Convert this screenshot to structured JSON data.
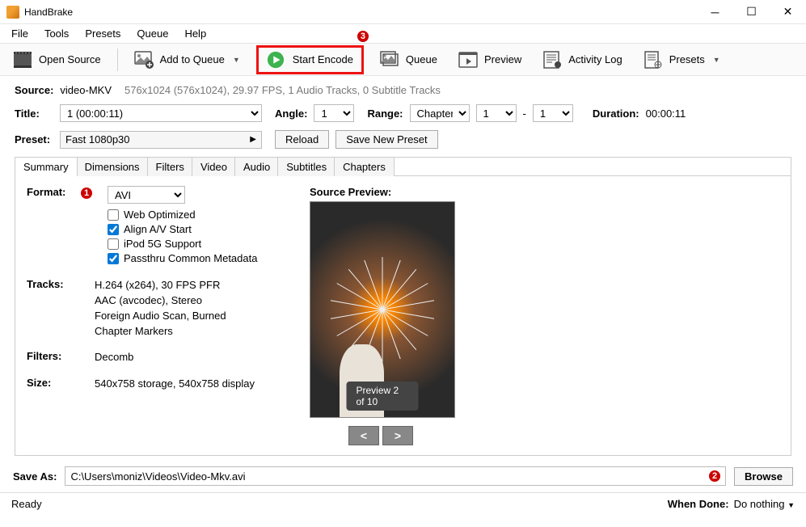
{
  "window": {
    "title": "HandBrake"
  },
  "menubar": [
    "File",
    "Tools",
    "Presets",
    "Queue",
    "Help"
  ],
  "toolbar": {
    "open_source": "Open Source",
    "add_to_queue": "Add to Queue",
    "start_encode": "Start Encode",
    "queue": "Queue",
    "preview": "Preview",
    "activity_log": "Activity Log",
    "presets": "Presets"
  },
  "badges": {
    "one": "1",
    "two": "2",
    "three": "3"
  },
  "source": {
    "label": "Source:",
    "name": "video-MKV",
    "details": "576x1024 (576x1024), 29.97 FPS, 1 Audio Tracks, 0 Subtitle Tracks"
  },
  "title": {
    "label": "Title:",
    "value": "1  (00:00:11)",
    "angle_label": "Angle:",
    "angle_value": "1",
    "range_label": "Range:",
    "range_type": "Chapters",
    "range_from": "1",
    "range_sep": "-",
    "range_to": "1",
    "duration_label": "Duration:",
    "duration_value": "00:00:11"
  },
  "preset": {
    "label": "Preset:",
    "value": "Fast 1080p30",
    "reload": "Reload",
    "save_new": "Save New Preset"
  },
  "tabs": [
    "Summary",
    "Dimensions",
    "Filters",
    "Video",
    "Audio",
    "Subtitles",
    "Chapters"
  ],
  "summary": {
    "format_label": "Format:",
    "format_value": "AVI",
    "checks": {
      "web_optimized": "Web Optimized",
      "align_av": "Align A/V Start",
      "ipod": "iPod 5G Support",
      "passthru": "Passthru Common Metadata"
    },
    "tracks_label": "Tracks:",
    "tracks_lines": [
      "H.264 (x264), 30 FPS PFR",
      "AAC (avcodec), Stereo",
      "Foreign Audio Scan, Burned",
      "Chapter Markers"
    ],
    "filters_label": "Filters:",
    "filters_value": "Decomb",
    "size_label": "Size:",
    "size_value": "540x758 storage, 540x758 display"
  },
  "preview": {
    "label": "Source Preview:",
    "counter": "Preview 2 of 10",
    "prev": "<",
    "next": ">"
  },
  "saveas": {
    "label": "Save As:",
    "path": "C:\\Users\\moniz\\Videos\\Video-Mkv.avi",
    "browse": "Browse"
  },
  "status": {
    "ready": "Ready",
    "when_done_label": "When Done:",
    "when_done_value": "Do nothing"
  }
}
